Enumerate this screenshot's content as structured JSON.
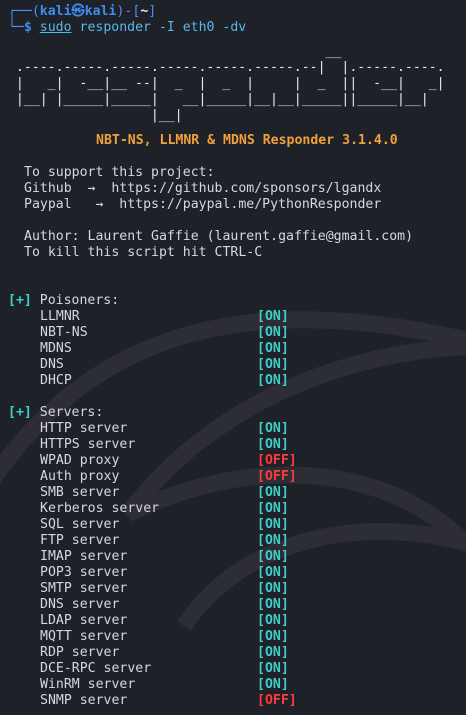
{
  "prompt": {
    "corner_top": "┌──(",
    "user": "kali",
    "at_symbol": "㉿",
    "host": "kali",
    "dir_open": ")-[",
    "dir": "~",
    "dir_close": "]",
    "corner_bottom": "└─",
    "dollar": "$",
    "cmd_sudo": "sudo",
    "cmd_rest": "responder -I eth0 -dv"
  },
  "banner": [
    "                                         __",
    "  .----.-----.-----.-----.-----.-----.--|  |.-----.----.",
    "  |   _|  -__|__ --|  _  |  _  |     |  _  ||  -__|   _|",
    "  |__| |_____|_____|   __|_____|__|__|_____||_____|__|",
    "                   |__|"
  ],
  "title": "NBT-NS, LLMNR & MDNS Responder 3.1.4.0",
  "support": {
    "heading": "To support this project:",
    "github": "Github  →  https://github.com/sponsors/lgandx",
    "paypal": "Paypal   →  https://paypal.me/PythonResponder"
  },
  "author": "Author: Laurent Gaffie (laurent.gaffie@gmail.com)",
  "kill": "To kill this script hit CTRL-C",
  "poisoners": {
    "marker": "[+]",
    "heading": "Poisoners:",
    "items": [
      {
        "label": "LLMNR",
        "status": "[ON]"
      },
      {
        "label": "NBT-NS",
        "status": "[ON]"
      },
      {
        "label": "MDNS",
        "status": "[ON]"
      },
      {
        "label": "DNS",
        "status": "[ON]"
      },
      {
        "label": "DHCP",
        "status": "[ON]"
      }
    ]
  },
  "servers": {
    "marker": "[+]",
    "heading": "Servers:",
    "items": [
      {
        "label": "HTTP server",
        "status": "[ON]"
      },
      {
        "label": "HTTPS server",
        "status": "[ON]"
      },
      {
        "label": "WPAD proxy",
        "status": "[OFF]"
      },
      {
        "label": "Auth proxy",
        "status": "[OFF]"
      },
      {
        "label": "SMB server",
        "status": "[ON]"
      },
      {
        "label": "Kerberos server",
        "status": "[ON]"
      },
      {
        "label": "SQL server",
        "status": "[ON]"
      },
      {
        "label": "FTP server",
        "status": "[ON]"
      },
      {
        "label": "IMAP server",
        "status": "[ON]"
      },
      {
        "label": "POP3 server",
        "status": "[ON]"
      },
      {
        "label": "SMTP server",
        "status": "[ON]"
      },
      {
        "label": "DNS server",
        "status": "[ON]"
      },
      {
        "label": "LDAP server",
        "status": "[ON]"
      },
      {
        "label": "MQTT server",
        "status": "[ON]"
      },
      {
        "label": "RDP server",
        "status": "[ON]"
      },
      {
        "label": "DCE-RPC server",
        "status": "[ON]"
      },
      {
        "label": "WinRM server",
        "status": "[ON]"
      },
      {
        "label": "SNMP server",
        "status": "[OFF]"
      }
    ]
  },
  "colors": {
    "background": "#1f2128",
    "on": "#3fd0c8",
    "off": "#ff3b3b",
    "title": "#f0a23a",
    "prompt_blue": "#4f8cff"
  }
}
